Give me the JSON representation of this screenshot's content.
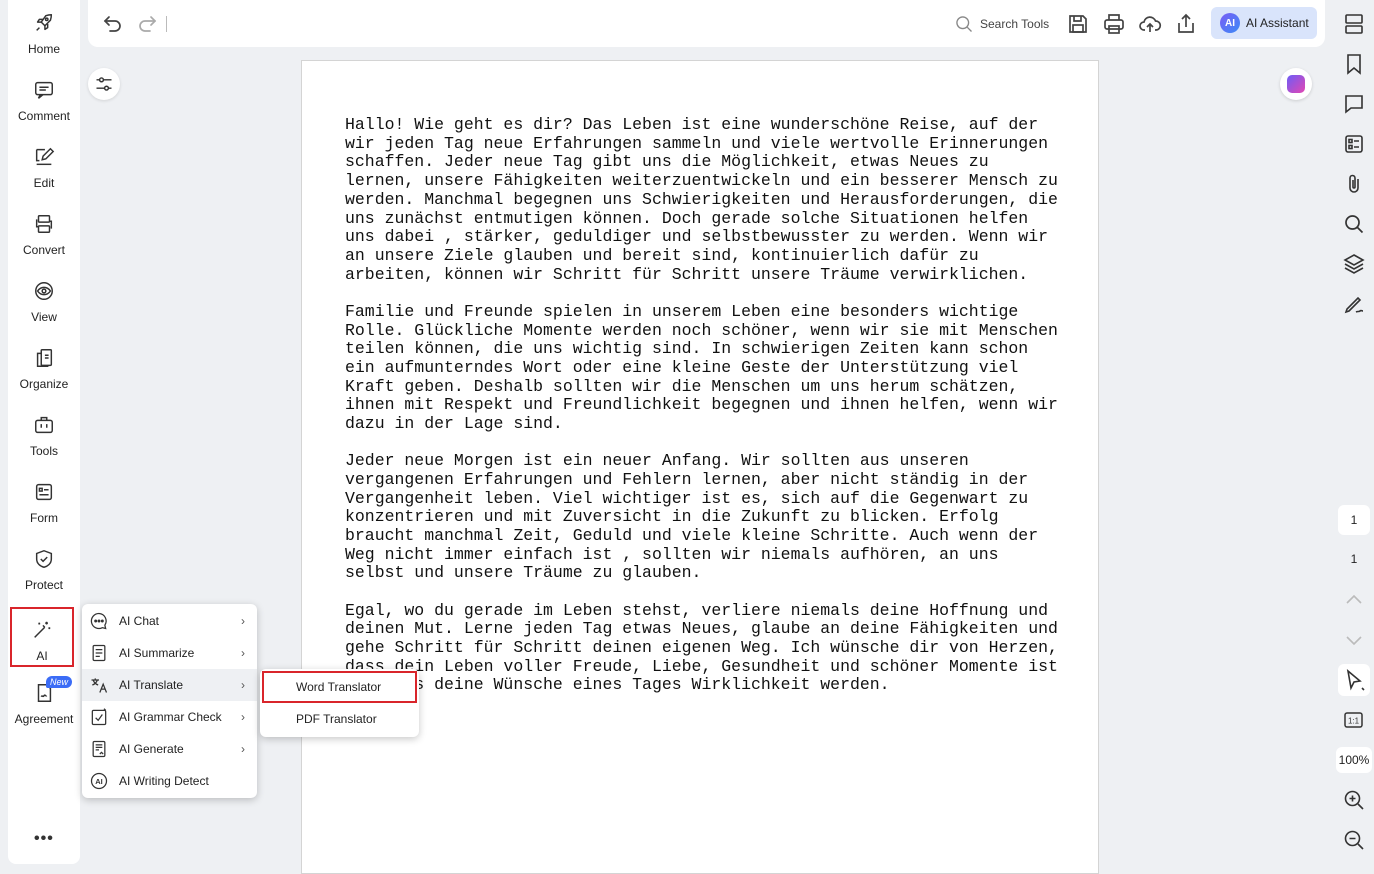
{
  "left_nav": {
    "items": [
      {
        "label": "Home",
        "icon": "rocket-icon"
      },
      {
        "label": "Comment",
        "icon": "comment-icon"
      },
      {
        "label": "Edit",
        "icon": "edit-icon"
      },
      {
        "label": "Convert",
        "icon": "convert-icon"
      },
      {
        "label": "View",
        "icon": "eye-icon"
      },
      {
        "label": "Organize",
        "icon": "organize-icon"
      },
      {
        "label": "Tools",
        "icon": "toolbox-icon"
      },
      {
        "label": "Form",
        "icon": "form-icon"
      },
      {
        "label": "Protect",
        "icon": "shield-icon"
      },
      {
        "label": "AI",
        "icon": "magic-wand-icon"
      },
      {
        "label": "Agreement",
        "icon": "agreement-icon",
        "badge": "New"
      }
    ],
    "more": "•••"
  },
  "toolbar": {
    "search_label": "Search Tools",
    "ai_assistant_label": "AI Assistant",
    "ai_logo_text": "AI"
  },
  "document": {
    "paragraphs": [
      "Hallo! Wie geht es dir? Das Leben ist eine wunderschöne Reise, auf der wir jeden Tag neue Erfahrungen sammeln und viele wertvolle Erinnerungen schaffen. Jeder neue Tag gibt uns die Möglichkeit, etwas Neues zu lernen, unsere Fähigkeiten weiterzuentwickeln und ein besserer Mensch zu werden. Manchmal begegnen uns Schwierigkeiten und Herausforderungen, die uns zunächst entmutigen können. Doch gerade solche Situationen helfen uns dabei , stärker, geduldiger und selbstbewusster zu werden. Wenn wir an unsere Ziele glauben und bereit sind, kontinuierlich dafür zu arbeiten, können wir Schritt für Schritt unsere Träume verwirklichen.",
      "Familie und Freunde spielen in unserem Leben eine besonders wichtige Rolle. Glückliche Momente werden noch schöner, wenn wir sie mit Menschen teilen können, die uns wichtig sind. In schwierigen Zeiten kann schon ein aufmunterndes Wort oder eine kleine Geste der Unterstützung viel Kraft geben. Deshalb sollten wir die Menschen um uns herum schätzen, ihnen mit Respekt und Freundlichkeit begegnen und ihnen helfen, wenn wir dazu in der Lage sind.",
      "Jeder neue Morgen ist ein neuer Anfang. Wir sollten aus unseren vergangenen Erfahrungen und Fehlern lernen, aber nicht ständig in der Vergangenheit leben. Viel wichtiger ist es, sich auf die Gegenwart zu konzentrieren und mit Zuversicht in die Zukunft zu blicken. Erfolg braucht manchmal Zeit, Geduld und viele kleine Schritte. Auch wenn der Weg nicht immer einfach ist , sollten wir niemals aufhören, an uns selbst und unsere Träume zu glauben.",
      "Egal, wo du gerade im Leben stehst, verliere niemals deine Hoffnung und deinen Mut. Lerne jeden Tag etwas Neues, glaube an deine Fähigkeiten und gehe Schritt für Schritt deinen eigenen Weg. Ich wünsche dir von Herzen, dass dein Leben voller Freude, Liebe, Gesundheit und schöner Momente ist und dass deine Wünsche eines Tages Wirklichkeit werden."
    ]
  },
  "ai_menu": {
    "items": [
      {
        "label": "AI Chat",
        "icon": "ai-chat-icon",
        "has_submenu": true
      },
      {
        "label": "AI Summarize",
        "icon": "summarize-icon",
        "has_submenu": true
      },
      {
        "label": "AI Translate",
        "icon": "translate-icon",
        "has_submenu": true,
        "active": true
      },
      {
        "label": "AI Grammar Check",
        "icon": "grammar-check-icon",
        "has_submenu": true
      },
      {
        "label": "AI Generate",
        "icon": "generate-icon",
        "has_submenu": true
      },
      {
        "label": "AI Writing Detect",
        "icon": "writing-detect-icon",
        "has_submenu": false
      }
    ],
    "chevron": "›"
  },
  "translate_submenu": {
    "word_translator": "Word Translator",
    "pdf_translator": "PDF Translator"
  },
  "right_bar": {
    "page_current": "1",
    "page_total": "1",
    "zoom": "100%",
    "fit_label": "1:1"
  },
  "colors": {
    "highlight_outline": "#d9252b",
    "ai_assistant_bg": "#d9e4fb",
    "app_background": "#eef0f3"
  }
}
